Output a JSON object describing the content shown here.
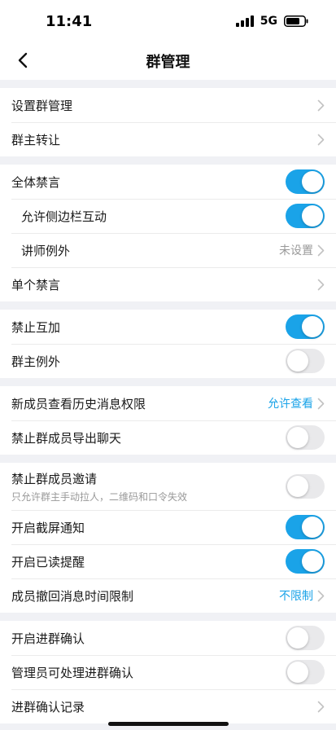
{
  "status_bar": {
    "time": "11:41",
    "network": "5G"
  },
  "nav": {
    "title": "群管理"
  },
  "colors": {
    "accent": "#1aa3e8",
    "toggle_off": "#e9e9eb",
    "background": "#f0f1f5"
  },
  "groups": [
    {
      "rows": [
        {
          "label": "设置群管理",
          "control": "chevron"
        },
        {
          "label": "群主转让",
          "control": "chevron"
        }
      ]
    },
    {
      "rows": [
        {
          "label": "全体禁言",
          "control": "toggle",
          "on": true
        },
        {
          "label": "允许侧边栏互动",
          "control": "toggle",
          "on": true,
          "indent": true
        },
        {
          "label": "讲师例外",
          "control": "chevron",
          "value": "未设置",
          "indent": true
        },
        {
          "label": "单个禁言",
          "control": "chevron"
        }
      ]
    },
    {
      "rows": [
        {
          "label": "禁止互加",
          "control": "toggle",
          "on": true
        },
        {
          "label": "群主例外",
          "control": "toggle",
          "on": false
        }
      ]
    },
    {
      "rows": [
        {
          "label": "新成员查看历史消息权限",
          "control": "chevron",
          "value": "允许查看",
          "accent": true
        },
        {
          "label": "禁止群成员导出聊天",
          "control": "toggle",
          "on": false
        }
      ]
    },
    {
      "rows": [
        {
          "label": "禁止群成员邀请",
          "sub": "只允许群主手动拉人，二维码和口令失效",
          "control": "toggle",
          "on": false
        },
        {
          "label": "开启截屏通知",
          "control": "toggle",
          "on": true
        },
        {
          "label": "开启已读提醒",
          "control": "toggle",
          "on": true
        },
        {
          "label": "成员撤回消息时间限制",
          "control": "chevron",
          "value": "不限制",
          "accent": true
        }
      ]
    },
    {
      "rows": [
        {
          "label": "开启进群确认",
          "control": "toggle",
          "on": false
        },
        {
          "label": "管理员可处理进群确认",
          "control": "toggle",
          "on": false
        },
        {
          "label": "进群确认记录",
          "control": "chevron"
        }
      ]
    }
  ]
}
